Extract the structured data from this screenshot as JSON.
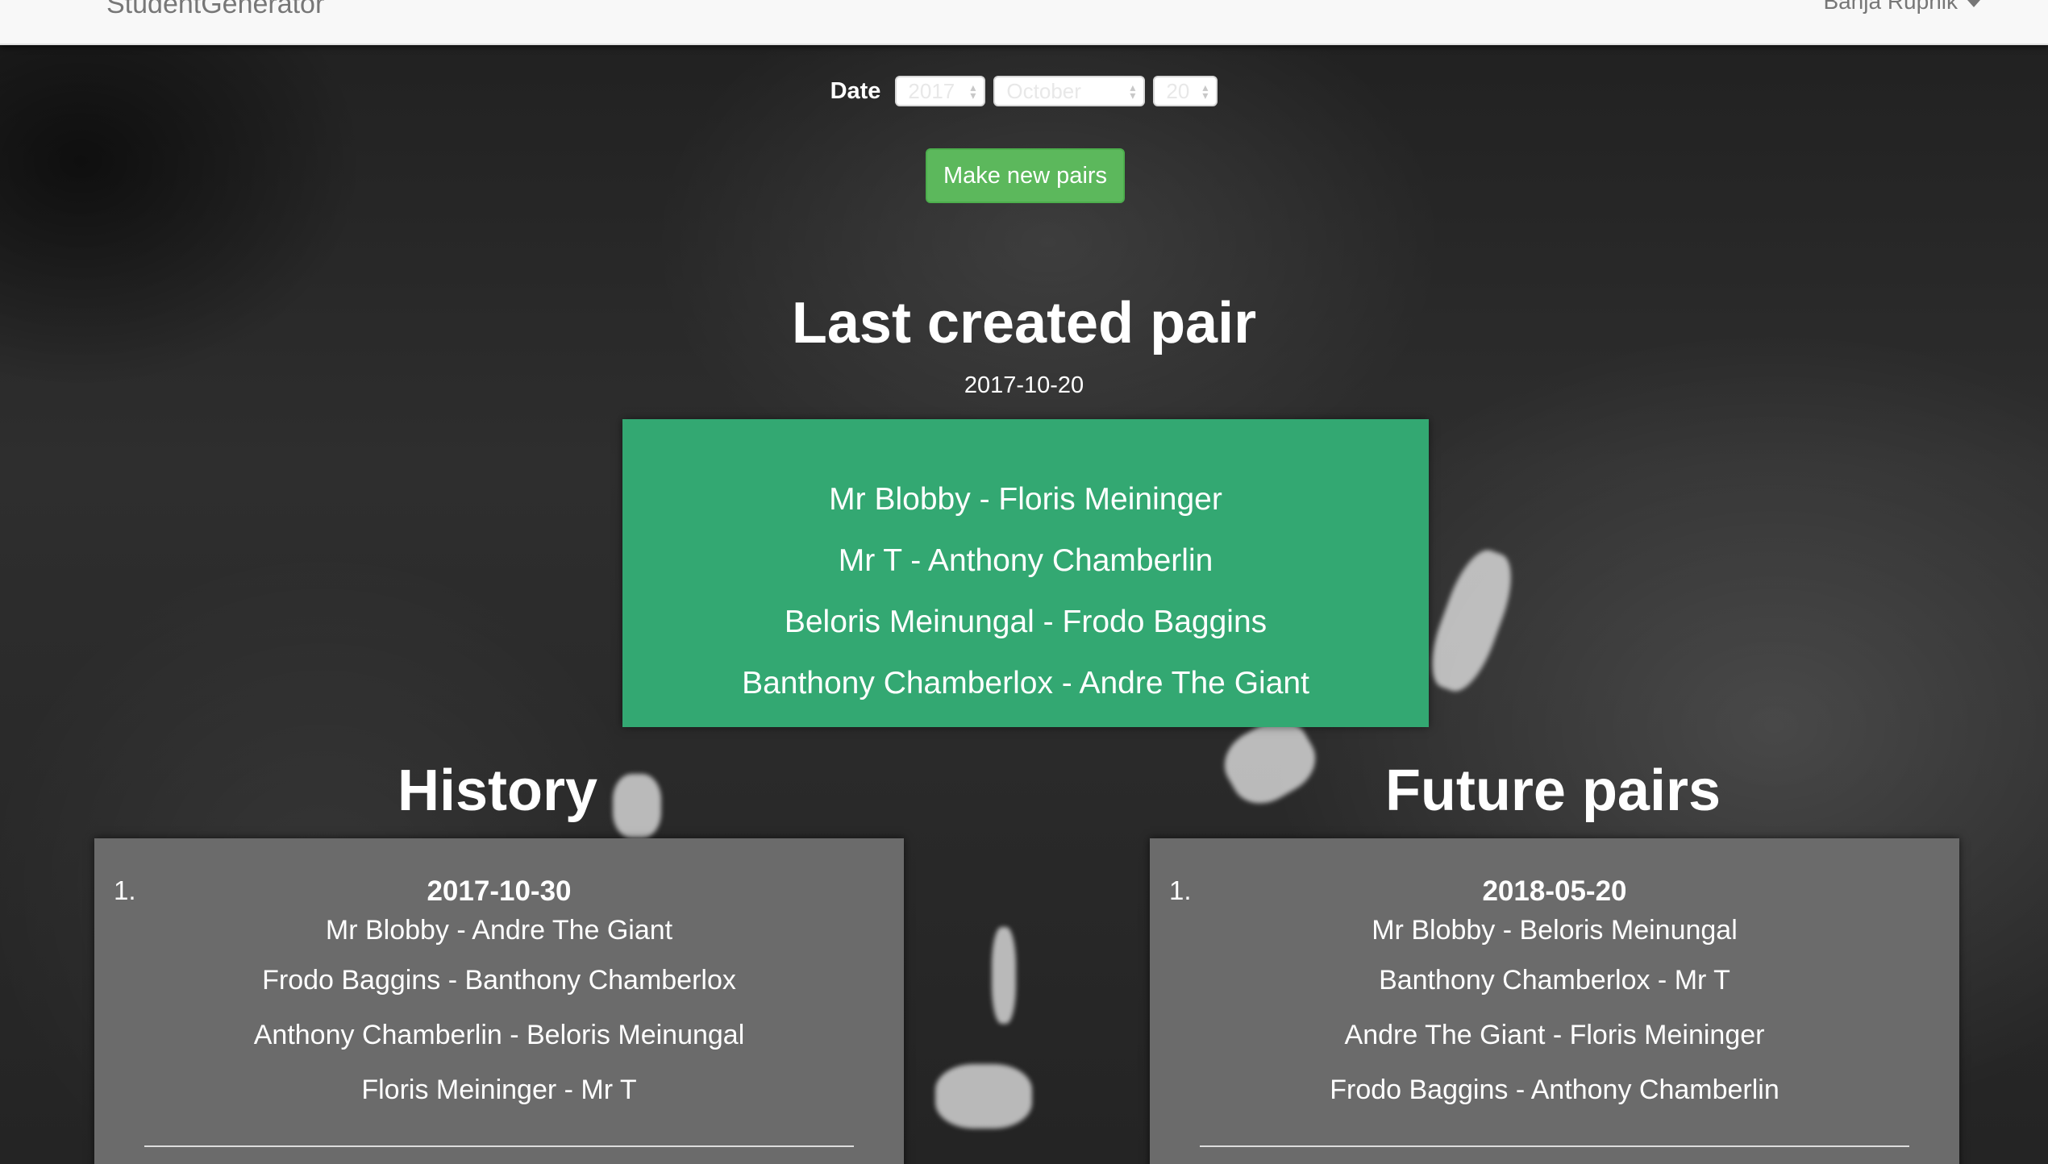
{
  "navbar": {
    "brand": "StudentGenerator",
    "user": "Banja Rupnik"
  },
  "date_picker": {
    "label": "Date",
    "year": "2017",
    "month": "October",
    "day": "20"
  },
  "make_button": "Make new pairs",
  "last_created": {
    "title": "Last created pair",
    "date": "2017-10-20",
    "pairs": [
      "Mr Blobby - Floris Meininger",
      "Mr T - Anthony Chamberlin",
      "Beloris Meinungal - Frodo Baggins",
      "Banthony Chamberlox - Andre The Giant"
    ]
  },
  "history": {
    "title": "History",
    "entries": [
      {
        "number": "1.",
        "date": "2017-10-30",
        "pairs": [
          "Mr Blobby - Andre The Giant",
          "Frodo Baggins - Banthony Chamberlox",
          "Anthony Chamberlin - Beloris Meinungal",
          "Floris Meininger - Mr T"
        ]
      }
    ]
  },
  "future": {
    "title": "Future pairs",
    "entries": [
      {
        "number": "1.",
        "date": "2018-05-20",
        "pairs": [
          "Mr Blobby - Beloris Meinungal",
          "Banthony Chamberlox - Mr T",
          "Andre The Giant - Floris Meininger",
          "Frodo Baggins - Anthony Chamberlin"
        ]
      }
    ]
  }
}
